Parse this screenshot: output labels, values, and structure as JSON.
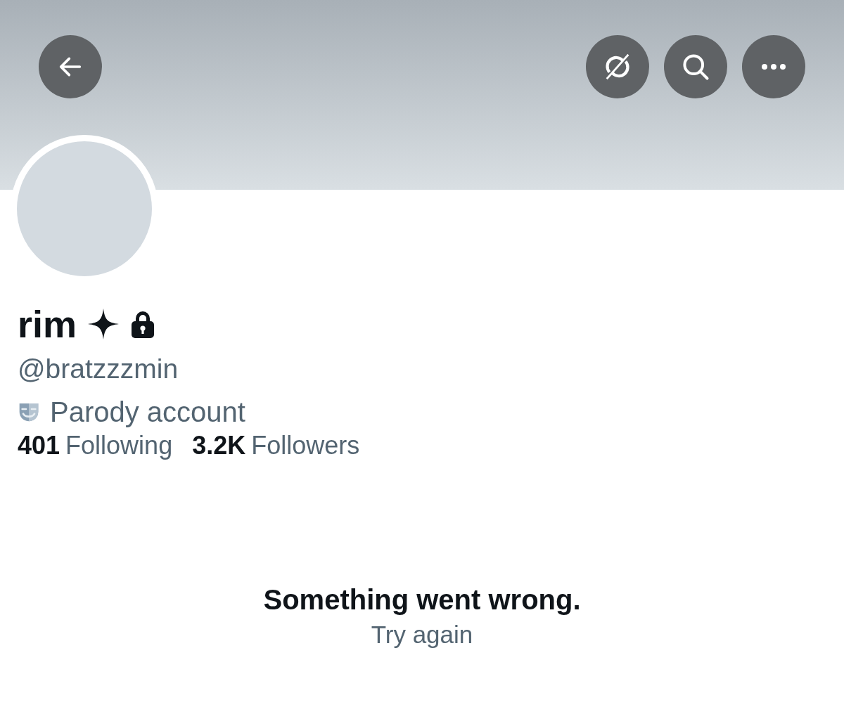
{
  "profile": {
    "name": "rim",
    "handle": "@bratzzzmin",
    "label": "Parody account",
    "protected": true
  },
  "stats": [
    {
      "count": "401",
      "label": "Following"
    },
    {
      "count": "3.2K",
      "label": "Followers"
    }
  ],
  "error": {
    "title": "Something went wrong.",
    "action": "Try again"
  }
}
